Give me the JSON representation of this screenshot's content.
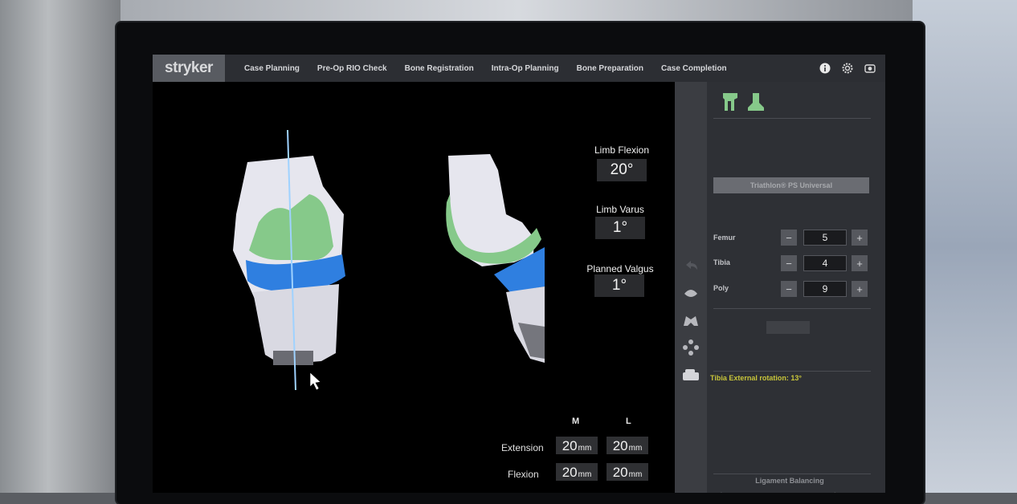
{
  "app": {
    "logo": "stryker",
    "nav_tabs": [
      "Case Planning",
      "Pre-Op RIO Check",
      "Bone Registration",
      "Intra-Op Planning",
      "Bone Preparation",
      "Case Completion"
    ],
    "icons": [
      "info-icon",
      "gear-icon",
      "camera-icon"
    ]
  },
  "readouts": {
    "limb_flexion": {
      "label": "Limb Flexion",
      "value": "20°"
    },
    "limb_varus": {
      "label": "Limb Varus",
      "value": "1°"
    },
    "planned_valgus": {
      "label": "Planned Valgus",
      "value": "1°"
    }
  },
  "gaps": {
    "columns": [
      "M",
      "L"
    ],
    "unit": "mm",
    "rows": [
      {
        "label": "Extension",
        "values": [
          "20",
          "20"
        ]
      },
      {
        "label": "Flexion",
        "values": [
          "20",
          "20"
        ]
      }
    ]
  },
  "panel": {
    "implant": "Triathlon® PS Universal",
    "sizes": [
      {
        "label": "Femur",
        "value": "5"
      },
      {
        "label": "Tibia",
        "value": "4"
      },
      {
        "label": "Poly",
        "value": "9"
      }
    ],
    "minus": "−",
    "plus": "+",
    "rotation_note": "Tibia External rotation: 13°",
    "section_title": "Ligament Balancing",
    "prev": "‹",
    "next": "›"
  },
  "colors": {
    "implant_green": "#86c98a",
    "bearing_blue": "#2f7fe0",
    "bone_white": "#e6e6ee",
    "accent_yellow": "#c8c53a"
  }
}
